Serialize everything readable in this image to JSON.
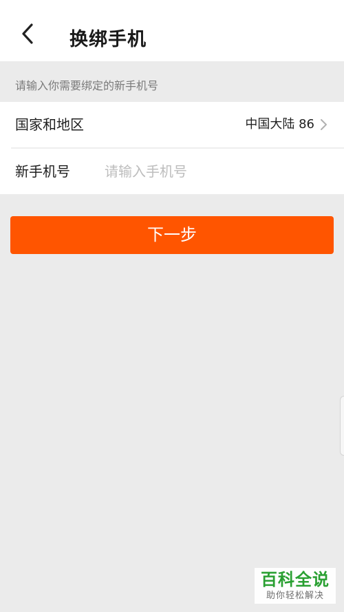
{
  "header": {
    "title": "换绑手机",
    "back_icon": "chevron-left-icon"
  },
  "form": {
    "hint": "请输入你需要绑定的新手机号",
    "region": {
      "label": "国家和地区",
      "value": "中国大陆 86",
      "icon": "chevron-right-icon"
    },
    "phone": {
      "label": "新手机号",
      "value": "",
      "placeholder": "请输入手机号"
    }
  },
  "actions": {
    "next_label": "下一步"
  },
  "colors": {
    "accent": "#ff5500",
    "background": "#ebebeb",
    "watermark_green": "#2aa032"
  },
  "watermark": {
    "title": "百科全说",
    "subtitle": "助你轻松解决"
  }
}
